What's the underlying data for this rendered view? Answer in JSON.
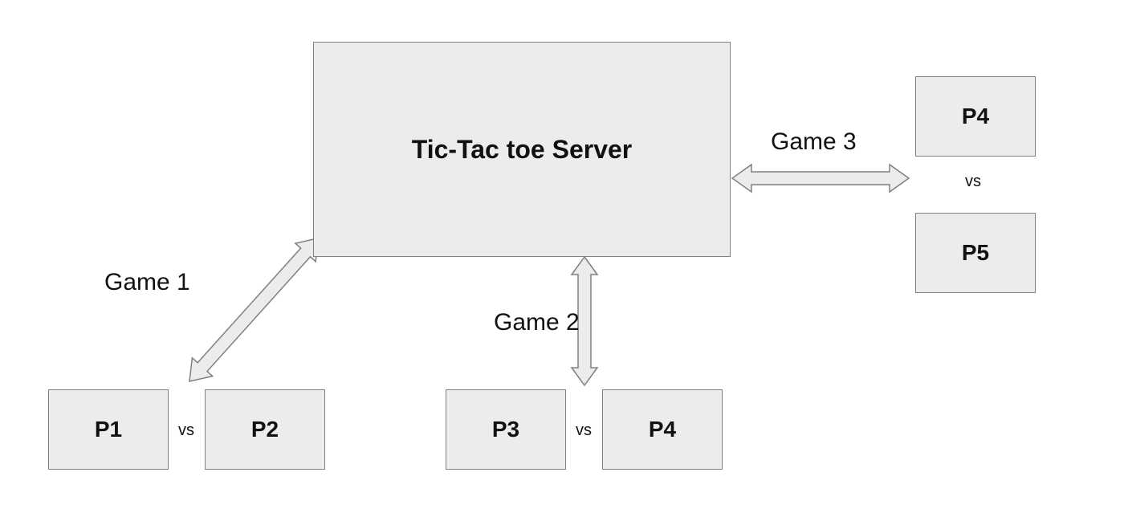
{
  "server": {
    "label": "Tic-Tac toe Server"
  },
  "games": [
    {
      "label": "Game 1",
      "players": [
        {
          "label": "P1"
        },
        {
          "label": "P2"
        }
      ],
      "vs_label": "vs"
    },
    {
      "label": "Game 2",
      "players": [
        {
          "label": "P3"
        },
        {
          "label": "P4"
        }
      ],
      "vs_label": "vs"
    },
    {
      "label": "Game 3",
      "players": [
        {
          "label": "P4"
        },
        {
          "label": "P5"
        }
      ],
      "vs_label": "vs"
    }
  ],
  "colors": {
    "box_fill": "#ececec",
    "box_border": "#808080",
    "arrow_fill": "#ececec",
    "arrow_stroke": "#808080",
    "text": "#111111",
    "background": "#ffffff"
  }
}
